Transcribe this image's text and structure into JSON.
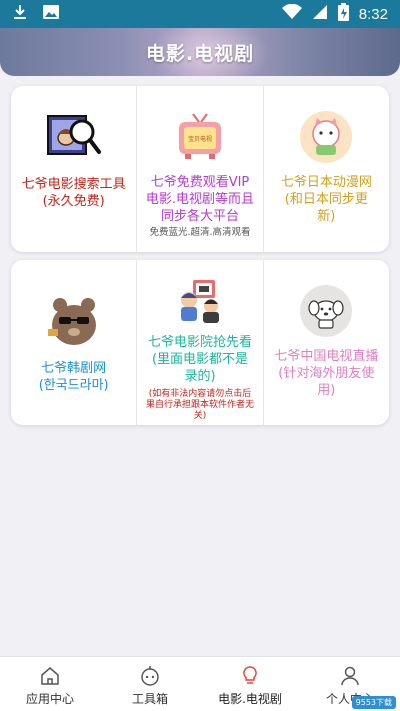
{
  "status_bar": {
    "time": "8:32",
    "icons": [
      "download-icon",
      "image-icon",
      "wifi-icon",
      "signal-icon",
      "battery-charging-icon"
    ]
  },
  "header": {
    "title": "电影.电视剧"
  },
  "cards": [
    {
      "cells": [
        {
          "icon": "movie-search-icon",
          "title": "七爷电影搜索工具\n(永久免费)",
          "color": "#c0241b"
        },
        {
          "icon": "tv-icon",
          "title": "七爷免费观看VIP\n电影.电视剧等而且\n同步各大平台",
          "subtitle": "免费蓝光.超清.高清观看",
          "color": "#b53bd1"
        },
        {
          "icon": "anime-mascot-icon",
          "title": "七爷日本动漫网\n(和日本同步更\n新)",
          "color": "#d4a017"
        }
      ]
    },
    {
      "cells": [
        {
          "icon": "bear-sunglasses-icon",
          "title": "七爷韩剧网\n(한국드라마)",
          "color": "#1a8fd6"
        },
        {
          "icon": "cinema-kids-icon",
          "title": "七爷电影院抢先看\n(里面电影都不是\n录的)",
          "note": "(如有非法内容请勿点击后\n果自行承担跟本软件作者无\n关)",
          "color": "#18b6a0"
        },
        {
          "icon": "dog-icon",
          "title": "七爷中国电视直播\n(针对海外朋友使\n用)",
          "color": "#e27fbf"
        }
      ]
    }
  ],
  "bottom_nav": [
    {
      "label": "应用中心",
      "icon": "home-icon"
    },
    {
      "label": "工具箱",
      "icon": "toolbox-icon"
    },
    {
      "label": "电影.电视剧",
      "icon": "lightbulb-icon",
      "active": true
    },
    {
      "label": "个人中心",
      "icon": "person-icon"
    }
  ],
  "watermark": "9553下载",
  "colors": {
    "status_bar": "#1b7a9c",
    "active_icon": "#e8453c"
  }
}
